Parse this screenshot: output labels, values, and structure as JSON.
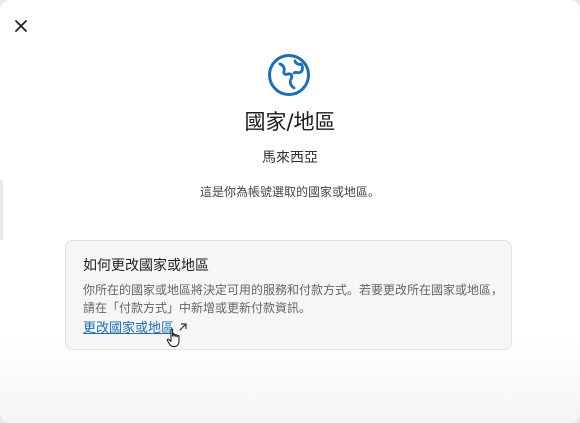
{
  "dialog": {
    "close_icon": "close-icon",
    "globe_icon": "globe-icon",
    "title": "國家/地區",
    "region_value": "馬來西亞",
    "description": "這是你為帳號選取的國家或地區。"
  },
  "info_card": {
    "heading": "如何更改國家或地區",
    "body_line1": "你所在的國家或地區將決定可用的服務和付款方式。若要更改所在國家或地區，",
    "body_line2": "請在「付款方式」中新增或更新付款資訊。",
    "link_label": "更改國家或地區",
    "link_icon": "external-link-icon"
  },
  "colors": {
    "accent": "#1a6fb8",
    "card_bg": "#f6f6f6"
  }
}
